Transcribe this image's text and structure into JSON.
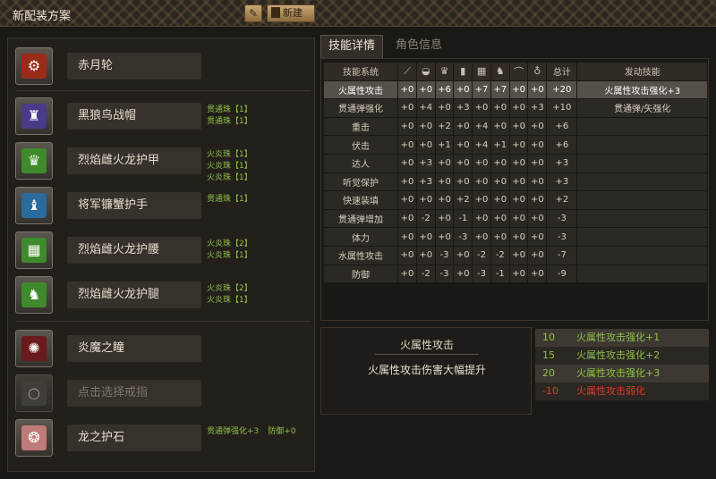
{
  "header": {
    "title": "新配装方案",
    "new_label": "新建"
  },
  "tabs": {
    "skills": "技能详情",
    "character": "角色信息"
  },
  "slots": [
    {
      "name": "赤月轮",
      "gems": []
    },
    {
      "name": "黑狼鸟战帽",
      "gems": [
        "贯通珠【1】",
        "贯通珠【1】"
      ]
    },
    {
      "name": "烈焰雌火龙护甲",
      "gems": [
        "火炎珠【1】",
        "火炎珠【1】",
        "火炎珠【1】"
      ]
    },
    {
      "name": "将军镰蟹护手",
      "gems": [
        "贯通珠【1】"
      ]
    },
    {
      "name": "烈焰雌火龙护腰",
      "gems": [
        "火炎珠【2】",
        "火炎珠【1】"
      ]
    },
    {
      "name": "烈焰雌火龙护腿",
      "gems": [
        "火炎珠【2】",
        "火炎珠【1】"
      ]
    },
    {
      "name": "炎魔之瞳",
      "gems": []
    },
    {
      "name": "点击选择戒指",
      "gems": []
    },
    {
      "name": "龙之护石",
      "gems": [
        "贯通弹强化+3",
        "防御+0"
      ]
    }
  ],
  "skill_table": {
    "headers": {
      "system": "技能系统",
      "total": "总计",
      "active": "发动技能"
    },
    "rows": [
      {
        "name": "火属性攻击",
        "vals": [
          "+0",
          "+0",
          "+6",
          "+0",
          "+7",
          "+7",
          "+0",
          "+0"
        ],
        "total": "+20",
        "active": "火属性攻击强化+3"
      },
      {
        "name": "贯通弹强化",
        "vals": [
          "+0",
          "+4",
          "+0",
          "+3",
          "+0",
          "+0",
          "+0",
          "+3"
        ],
        "total": "+10",
        "active": "贯通弹/矢强化"
      },
      {
        "name": "重击",
        "vals": [
          "+0",
          "+0",
          "+2",
          "+0",
          "+4",
          "+0",
          "+0",
          "+0"
        ],
        "total": "+6",
        "active": ""
      },
      {
        "name": "伏击",
        "vals": [
          "+0",
          "+0",
          "+1",
          "+0",
          "+4",
          "+1",
          "+0",
          "+0"
        ],
        "total": "+6",
        "active": ""
      },
      {
        "name": "达人",
        "vals": [
          "+0",
          "+3",
          "+0",
          "+0",
          "+0",
          "+0",
          "+0",
          "+0"
        ],
        "total": "+3",
        "active": ""
      },
      {
        "name": "听觉保护",
        "vals": [
          "+0",
          "+3",
          "+0",
          "+0",
          "+0",
          "+0",
          "+0",
          "+0"
        ],
        "total": "+3",
        "active": ""
      },
      {
        "name": "快速装填",
        "vals": [
          "+0",
          "+0",
          "+0",
          "+2",
          "+0",
          "+0",
          "+0",
          "+0"
        ],
        "total": "+2",
        "active": ""
      },
      {
        "name": "贯通弹增加",
        "vals": [
          "+0",
          "-2",
          "+0",
          "-1",
          "+0",
          "+0",
          "+0",
          "+0"
        ],
        "total": "-3",
        "active": ""
      },
      {
        "name": "体力",
        "vals": [
          "+0",
          "+0",
          "+0",
          "-3",
          "+0",
          "+0",
          "+0",
          "+0"
        ],
        "total": "-3",
        "active": ""
      },
      {
        "name": "水属性攻击",
        "vals": [
          "+0",
          "+0",
          "-3",
          "+0",
          "-2",
          "-2",
          "+0",
          "+0"
        ],
        "total": "-7",
        "active": ""
      },
      {
        "name": "防御",
        "vals": [
          "+0",
          "-2",
          "-3",
          "+0",
          "-3",
          "-1",
          "+0",
          "+0"
        ],
        "total": "-9",
        "active": ""
      }
    ]
  },
  "description": {
    "title": "火属性攻击",
    "text": "火属性攻击伤害大幅提升"
  },
  "thresholds": [
    {
      "pts": "10",
      "label": "火属性攻击强化+1"
    },
    {
      "pts": "15",
      "label": "火属性攻击强化+2"
    },
    {
      "pts": "20",
      "label": "火属性攻击强化+3"
    },
    {
      "pts": "-10",
      "label": "火属性攻击弱化"
    }
  ],
  "colors": {
    "accent_green": "#8fc04a",
    "negative_red": "#e03a2a",
    "gold_button": "#b08c58"
  },
  "icons": {
    "edit": "pencil-icon",
    "new": "document-icon",
    "columns": [
      "weapon-icon",
      "helmet-icon",
      "chest-icon",
      "arm-icon",
      "waist-icon",
      "legs-icon",
      "ring-icon",
      "charm-icon"
    ]
  }
}
